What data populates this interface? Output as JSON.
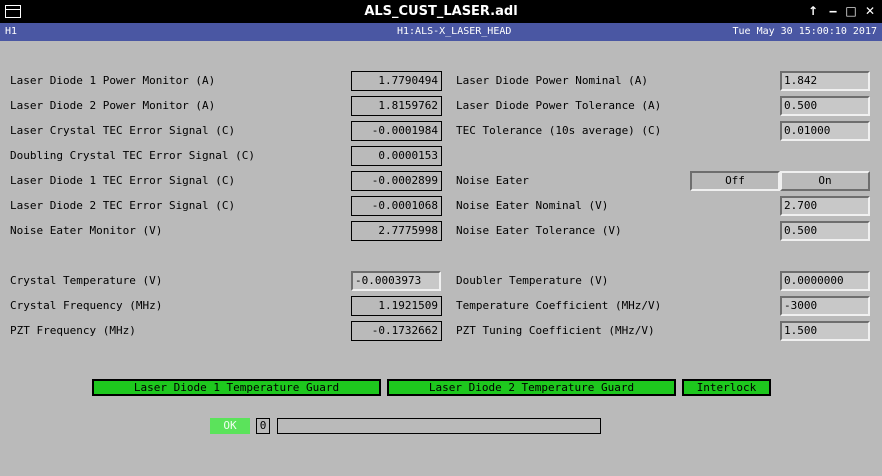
{
  "window": {
    "title": "ALS_CUST_LASER.adl"
  },
  "header": {
    "site": "H1",
    "channel": "H1:ALS-X_LASER_HEAD",
    "timestamp": "Tue May 30 15:00:10 2017"
  },
  "left_rows": [
    {
      "label": "Laser Diode 1 Power Monitor (A)",
      "value": "1.7790494"
    },
    {
      "label": "Laser Diode 2 Power Monitor (A)",
      "value": "1.8159762"
    },
    {
      "label": "Laser Crystal TEC Error Signal (C)",
      "value": "-0.0001984"
    },
    {
      "label": "Doubling Crystal TEC Error Signal (C)",
      "value": "0.0000153"
    },
    {
      "label": "Laser Diode 1 TEC Error Signal (C)",
      "value": "-0.0002899"
    },
    {
      "label": "Laser Diode 2 TEC Error Signal (C)",
      "value": "-0.0001068"
    },
    {
      "label": "Noise Eater Monitor (V)",
      "value": "2.7775998"
    }
  ],
  "left_rows2": [
    {
      "label": "Crystal Temperature (V)",
      "value": "-0.0003973"
    },
    {
      "label": "Crystal Frequency (MHz)",
      "value": "1.1921509"
    },
    {
      "label": "PZT Frequency (MHz)",
      "value": "-0.1732662"
    }
  ],
  "right_rows": [
    {
      "label": "Laser Diode Power Nominal (A)",
      "value": "1.842"
    },
    {
      "label": "Laser Diode Power Tolerance (A)",
      "value": "0.500"
    },
    {
      "label": "TEC Tolerance (10s average) (C)",
      "value": "0.01000"
    }
  ],
  "noise_eater": {
    "label": "Noise Eater",
    "off": "Off",
    "on": "On"
  },
  "right_rows_ne": [
    {
      "label": "Noise Eater Nominal (V)",
      "value": "2.700"
    },
    {
      "label": "Noise Eater Tolerance (V)",
      "value": "0.500"
    }
  ],
  "right_rows2": [
    {
      "label": "Doubler Temperature (V)",
      "value": "0.0000000"
    },
    {
      "label": "Temperature Coefficient (MHz/V)",
      "value": "-3000"
    },
    {
      "label": "PZT Tuning Coefficient (MHz/V)",
      "value": "1.500"
    }
  ],
  "guards": {
    "ld1": "Laser Diode 1 Temperature Guard",
    "ld2": "Laser Diode 2 Temperature Guard",
    "interlock": "Interlock"
  },
  "status": {
    "ok": "OK",
    "count": "0",
    "progress": 0
  },
  "colors": {
    "header": "#4a57a3",
    "guard_green": "#1ec81e",
    "ok_green": "#5be35b",
    "background": "#bababa"
  }
}
